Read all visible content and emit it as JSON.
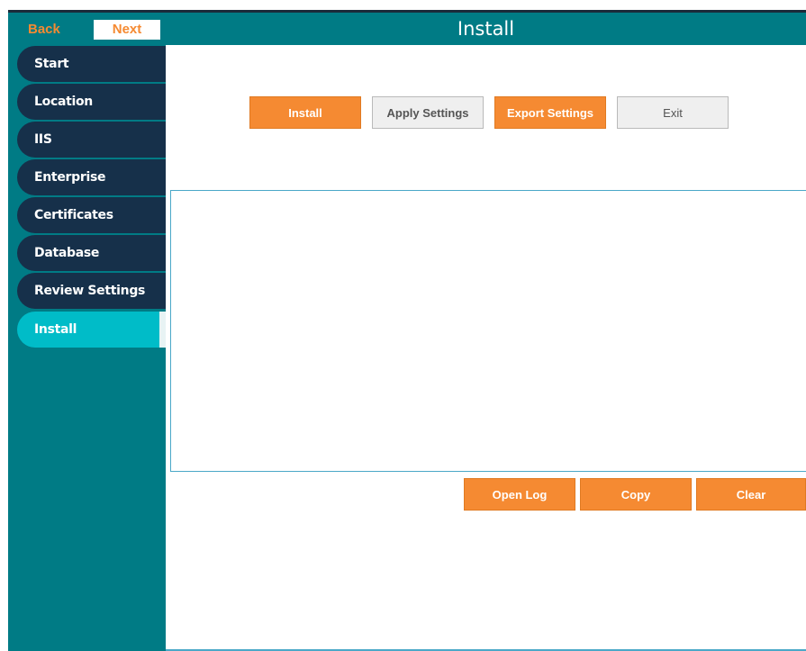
{
  "window": {
    "title": "Install"
  },
  "nav": {
    "back_label": "Back",
    "next_label": "Next"
  },
  "sidebar": {
    "items": [
      {
        "label": "Start",
        "active": false
      },
      {
        "label": "Location",
        "active": false
      },
      {
        "label": "IIS",
        "active": false
      },
      {
        "label": "Enterprise",
        "active": false
      },
      {
        "label": "Certificates",
        "active": false
      },
      {
        "label": "Database",
        "active": false
      },
      {
        "label": "Review Settings",
        "active": false
      },
      {
        "label": "Install",
        "active": true
      }
    ]
  },
  "actions": {
    "install_label": "Install",
    "apply_settings_label": "Apply Settings",
    "export_settings_label": "Export Settings",
    "exit_label": "Exit"
  },
  "log": {
    "content": "",
    "open_log_label": "Open Log",
    "copy_label": "Copy",
    "clear_label": "Clear"
  },
  "colors": {
    "teal": "#007b85",
    "navy": "#16304a",
    "active": "#00bcc8",
    "orange": "#f58a32"
  }
}
